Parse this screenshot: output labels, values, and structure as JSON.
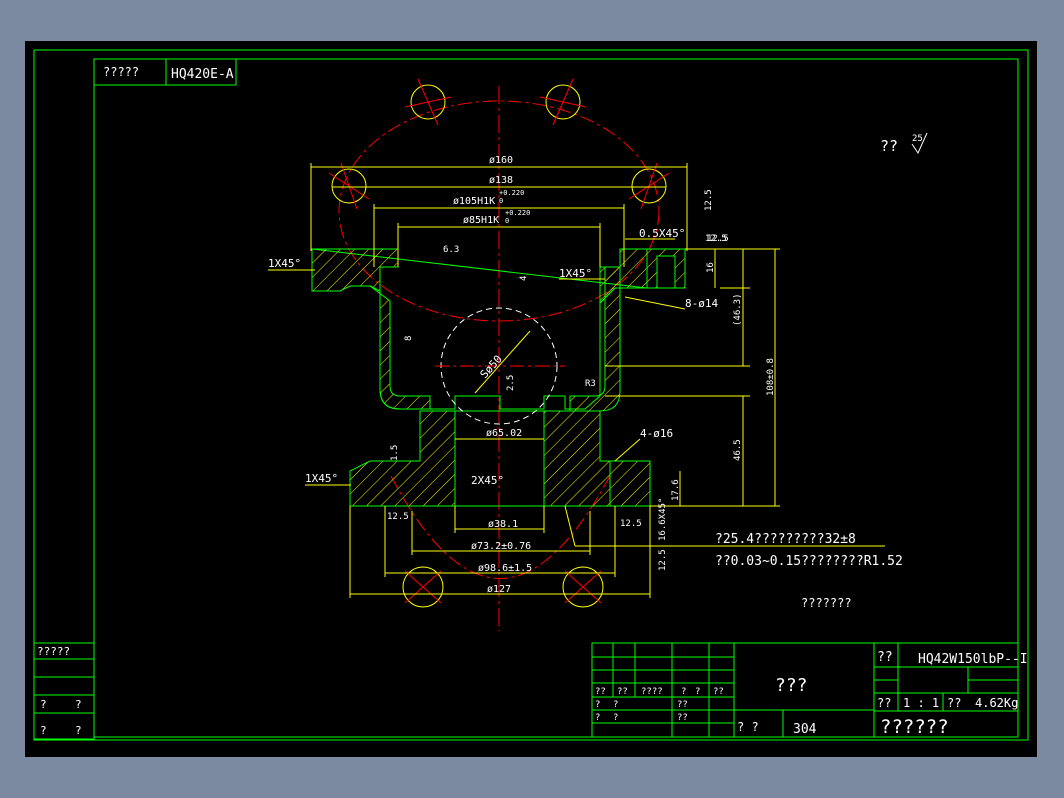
{
  "drawing": {
    "top_label_left": "?????",
    "top_label_code": "HQ420E-A",
    "roughness_note": "??",
    "roughness_symbol": "25",
    "dimensions": {
      "d160": "ø160",
      "d138": "ø138",
      "d105": "ø105H1K",
      "d105_tol": "+0.220",
      "d105_tol_low": "0",
      "d85": "ø85H1K",
      "d85_tol": "+0.220",
      "d85_tol_low": "0",
      "chamfer_05": "0.5X45°",
      "chamfer_1_a": "1X45°",
      "chamfer_1_b": "1X45°",
      "chamfer_1_c": "1X45°",
      "chamfer_2": "2X45°",
      "holes_8": "8-ø14",
      "holes_4": "4-ø16",
      "r63": "6.3",
      "r125_a": "12.5",
      "r125_b": "12.5",
      "r125_c": "12.5",
      "r125_d": "12.5",
      "r125_e": "12.5",
      "r125_f": "12.5",
      "h4": "4",
      "h16": "16",
      "h463": "(46.3)",
      "h108": "108±0.8",
      "h465": "46.5",
      "h176": "17.6",
      "h16b": "16.6X45°",
      "sphere": "Sø50",
      "d6502": "ø65.02",
      "d381": "ø38.1",
      "d732": "ø73.2±0.76",
      "d986": "ø98.6±1.5",
      "d127": "ø127",
      "note_line1": "?25.4?????????32±8",
      "note_line2": "??0.03~0.15????????R1.52",
      "bottom_note": "???????",
      "dim_1_5": "1.5",
      "dim_2_5": "2.5",
      "dim_8": "8",
      "dim_r3": "R3"
    }
  },
  "title_block": {
    "left_label": "?????",
    "left_cells": [
      "?",
      "?",
      "?",
      "?"
    ],
    "header_row": [
      "??",
      "??",
      "????",
      "?",
      "?",
      "??"
    ],
    "rows_a": [
      "?",
      "?",
      "??"
    ],
    "rows_b": [
      "?",
      "?",
      "??"
    ],
    "name": "???",
    "sign_label": "?  ?",
    "material": "304",
    "code_label": "??",
    "code": "HQ42W150lbP--I",
    "scale_label": "??",
    "scale": "1 : 1",
    "weight_label": "??",
    "weight": "4.62Kg",
    "company": "??????"
  },
  "colors": {
    "background": "#7b8aa1",
    "paper": "#000000",
    "frame": "#00ff00",
    "dimension": "#ffff00",
    "centerline": "#ff0000",
    "text": "#ffffff"
  }
}
